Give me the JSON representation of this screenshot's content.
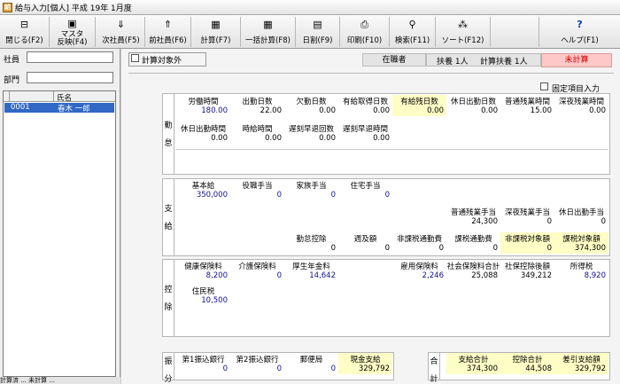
{
  "window": {
    "title": "給与入力[個人] 平成 19年 1月度",
    "icon": "app-icon"
  },
  "toolbar": [
    {
      "name": "close-button",
      "icon": "door-icon",
      "glyph": "⊟",
      "label": "閉じる(F2)"
    },
    {
      "name": "master-reflect-button",
      "icon": "computer-icon",
      "glyph": "▣",
      "label": "マスタ",
      "label2": "反映(F4)"
    },
    {
      "name": "next-employee-button",
      "icon": "person-arrow-icon",
      "glyph": "⇓",
      "label": "次社員(F5)"
    },
    {
      "name": "prev-employee-button",
      "icon": "person-arrow-icon",
      "glyph": "⇑",
      "label": "前社員(F6)"
    },
    {
      "name": "calculate-button",
      "icon": "calculator-icon",
      "glyph": "▦",
      "label": "計算(F7)"
    },
    {
      "name": "batch-calculate-button",
      "icon": "calculator-icon",
      "glyph": "▦",
      "label": "一括計算(F8)"
    },
    {
      "name": "daily-proration-button",
      "icon": "calendar-icon",
      "glyph": "▤",
      "label": "日割(F9)"
    },
    {
      "name": "print-button",
      "icon": "printer-icon",
      "glyph": "⎙",
      "label": "印刷(F10)"
    },
    {
      "name": "search-button",
      "icon": "search-icon",
      "glyph": "⚲",
      "label": "検索(F11)"
    },
    {
      "name": "sort-button",
      "icon": "sort-icon",
      "glyph": "⁂",
      "label": "ソート(F12)"
    },
    {
      "name": "help-button",
      "icon": "help-icon",
      "glyph": "?",
      "label": "ヘルプ(F1)"
    }
  ],
  "left": {
    "employee_label": "社員",
    "department_label": "部門",
    "col_name": "氏名",
    "rows": [
      {
        "code": "0001",
        "name": "春木 一郎"
      }
    ],
    "status": "計算済 ... 未計算 ..."
  },
  "header": {
    "exclude_label": "計算対象外",
    "status_employee": "在職者",
    "dependents": "扶養  1人",
    "tax_dependents": "計算扶養 1人",
    "calc_status": "未計算",
    "fixed_label": "固定項目入力"
  },
  "attendance": {
    "side": "勤怠",
    "labels1": [
      "労働時間",
      "出勤日数",
      "欠勤日数",
      "有給取得日数",
      "有給残日数",
      "休日出勤日数",
      "普通残業時間",
      "深夜残業時間"
    ],
    "values1": [
      "180.00",
      "22.00",
      "0.00",
      "0.00",
      "0.00",
      "0.00",
      "15.00",
      "0.00"
    ],
    "labels2": [
      "休日出勤時間",
      "時給時間",
      "遅刻早退回数",
      "遅刻早退時間"
    ],
    "values2": [
      "0.00",
      "0.00",
      "0.00",
      "0.00"
    ]
  },
  "pay": {
    "side": "支給",
    "labels1": [
      "基本給",
      "役職手当",
      "家族手当",
      "住宅手当"
    ],
    "values1": [
      "350,000",
      "0",
      "0",
      "0"
    ],
    "labels2": [
      "普通残業手当",
      "深夜残業手当",
      "休日出勤手当"
    ],
    "values2": [
      "24,300",
      "0",
      "0"
    ],
    "labels3": [
      "勤怠控除",
      "週及額",
      "非課税通勤費",
      "課税通勤費",
      "非課税対象額",
      "課税対象額"
    ],
    "values3": [
      "0",
      "0",
      "0",
      "0",
      "0",
      "374,300"
    ]
  },
  "deduction": {
    "side": "控除",
    "labels1": [
      "健康保険料",
      "介護保険料",
      "厚生年金料",
      "",
      "雇用保険料",
      "社会保険料合計",
      "社保控除後額",
      "所得税"
    ],
    "values1": [
      "8,200",
      "0",
      "14,642",
      "",
      "2,246",
      "25,088",
      "349,212",
      "8,920"
    ],
    "labels2": [
      "住民税"
    ],
    "values2": [
      "10,500"
    ]
  },
  "transfer": {
    "side": "振分",
    "labels": [
      "第1振込銀行",
      "第2振込銀行",
      "郵便局",
      "現金支給"
    ],
    "values": [
      "0",
      "0",
      "0",
      "329,792"
    ]
  },
  "totals": {
    "side": "合計",
    "labels": [
      "支給合計",
      "控除合計",
      "差引支給額"
    ],
    "values": [
      "374,300",
      "44,508",
      "329,792"
    ]
  }
}
